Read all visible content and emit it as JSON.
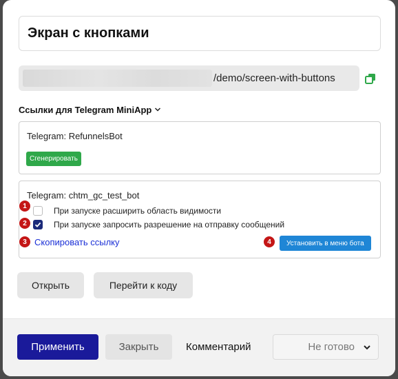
{
  "screen": {
    "title": "Экран с кнопками"
  },
  "url": {
    "path": "/demo/screen-with-buttons"
  },
  "links_section": {
    "label": "Ссылки для Telegram MiniApp"
  },
  "bots": [
    {
      "title": "Telegram: RefunnelsBot",
      "generate_label": "Сгенерировать"
    },
    {
      "title": "Telegram: chtm_gc_test_bot",
      "options": [
        {
          "label": "При запуске расширить область видимости",
          "checked": false,
          "badge": "1"
        },
        {
          "label": "При запуске запросить разрешение на отправку сообщений",
          "checked": true,
          "badge": "2"
        }
      ],
      "copy_link_label": "Скопировать ссылку",
      "copy_badge": "3",
      "menu_button_label": "Установить в меню бота",
      "menu_badge": "4"
    }
  ],
  "actions": {
    "open_label": "Открыть",
    "goto_code_label": "Перейти к коду"
  },
  "footer": {
    "apply_label": "Применить",
    "close_label": "Закрыть",
    "comment_label": "Комментарий",
    "status_value": "Не готово"
  },
  "colors": {
    "accent": "#1a1a9a",
    "green": "#2fa84a",
    "blue": "#1f86d6",
    "badge": "#c41616",
    "link": "#1a2fd6"
  },
  "icons": [
    "copy-icon",
    "chevron-down-icon",
    "checkmark-icon"
  ]
}
